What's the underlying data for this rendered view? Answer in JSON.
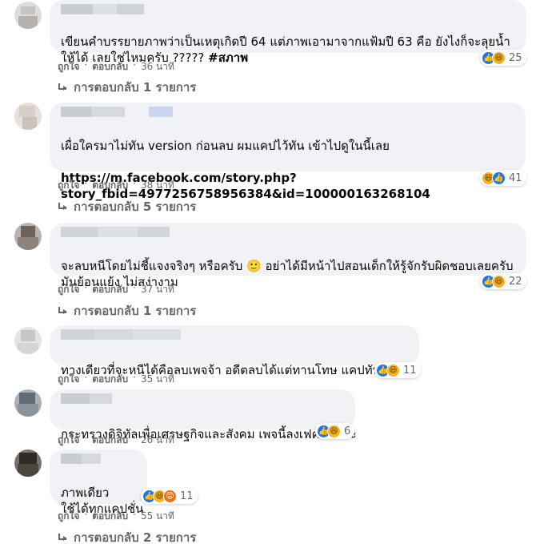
{
  "labels": {
    "like": "ถูกใจ",
    "reply": "ตอบกลับ",
    "separator": "·"
  },
  "comments": [
    {
      "text_1": "เขียนคำบรรยายภาพว่าเป็นเหตุเกิดปี 64 แต่ภาพเอามาจากแฟ้มปี 63 คือ ยังไงก็จะลุยน้ำให้ได้ เลยใช่ไหมครับ ????? ",
      "hashtag": "#สภาพ",
      "time": "36 นาที",
      "reaction_count": "25",
      "reactions": [
        "like-icon",
        "haha-icon"
      ],
      "replies": "การตอบกลับ 1 รายการ"
    },
    {
      "text_1": "เผื่อใครมาไม่ทัน version ก่อนลบ ผมแคปไว้ทัน เข้าไปดูในนี้เลย",
      "link": "https://m.facebook.com/story.php?\nstory_fbid=4977256758956384&id=100000163268104",
      "time": "38 นาที",
      "reaction_count": "41",
      "reactions": [
        "haha-icon",
        "like-icon"
      ],
      "replies": "การตอบกลับ 5 รายการ"
    },
    {
      "text_1": "จะลบหนีโดยไม่ชี้แจงจริงๆ หรือครับ 🙂 อย่าได้มีหน้าไปสอนเด็กให้รู้จักรับผิดชอบเลยครับ มันย้อนแย้ง ไม่สง่างาม",
      "time": "37 นาที",
      "reaction_count": "22",
      "reactions": [
        "like-icon",
        "haha-icon"
      ],
      "replies": "การตอบกลับ 1 รายการ"
    },
    {
      "text_1": "ทางเดียวที่จะหนีได้คือลบเพจจ้า อดีตลบได้แต่ทานโทษ แคปทัน 5555",
      "time": "35 นาที",
      "reaction_count": "11",
      "reactions": [
        "like-icon",
        "haha-icon"
      ]
    },
    {
      "text_1": "กระทรวงดิจิทัลเพื่อเศรษฐกิจและสังคม เพจนี้ลงเฟคนิวส์ค่ะ",
      "time": "26 นาที",
      "reaction_count": "6",
      "reactions": [
        "like-icon",
        "haha-icon"
      ]
    },
    {
      "text_1": "ภาพเดียว\nใช้ได้ทุกแคปชั่น",
      "time": "55 นาที",
      "reaction_count": "11",
      "reactions": [
        "like-icon",
        "haha-icon",
        "angry-icon"
      ],
      "replies": "การตอบกลับ 2 รายการ"
    }
  ],
  "colors": {
    "bubble": "#f0f2f5",
    "meta_text": "#65676b",
    "like": "#1877f2",
    "haha": "#f7b125",
    "angry": "#e9710f"
  }
}
